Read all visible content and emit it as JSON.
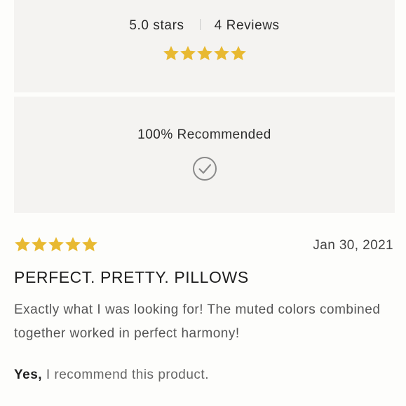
{
  "summary": {
    "rating_text": "5.0 stars",
    "reviews_text": "4 Reviews",
    "rating_value": 5,
    "rating_max": 5,
    "recommend_text": "100% Recommended",
    "check_icon": "check-circle-icon"
  },
  "review": {
    "rating_value": 5,
    "rating_max": 5,
    "date": "Jan 30, 2021",
    "title": "PERFECT. PRETTY. PILLOWS",
    "body": "Exactly what I was looking for! The muted colors combined together worked in perfect harmony!",
    "recommend_yes": "Yes,",
    "recommend_rest": " I recommend this product."
  },
  "colors": {
    "star": "#e8b931",
    "card_bg": "#f4f3f1",
    "page_bg": "#fdfdfb",
    "check": "#8a8a8a"
  }
}
